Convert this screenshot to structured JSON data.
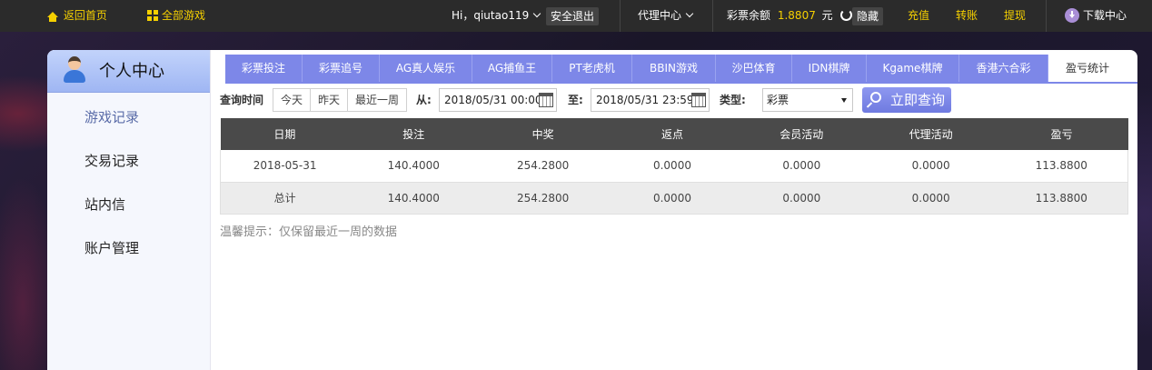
{
  "topbar": {
    "home_label": "返回首页",
    "all_games_label": "全部游戏",
    "greeting": "Hi，qiutao119",
    "logout_label": "安全退出",
    "agent_center_label": "代理中心",
    "balance_label": "彩票余额",
    "balance_value": "1.8807",
    "balance_unit": "元",
    "hide_label": "隐藏",
    "recharge_label": "充值",
    "transfer_label": "转账",
    "withdraw_label": "提现",
    "download_label": "下载中心"
  },
  "sidebar": {
    "title": "个人中心",
    "items": [
      {
        "label": "游戏记录"
      },
      {
        "label": "交易记录"
      },
      {
        "label": "站内信"
      },
      {
        "label": "账户管理"
      }
    ]
  },
  "tabs": [
    {
      "label": "彩票投注"
    },
    {
      "label": "彩票追号"
    },
    {
      "label": "AG真人娱乐"
    },
    {
      "label": "AG捕鱼王"
    },
    {
      "label": "PT老虎机"
    },
    {
      "label": "BBIN游戏"
    },
    {
      "label": "沙巴体育"
    },
    {
      "label": "IDN棋牌"
    },
    {
      "label": "Kgame棋牌"
    },
    {
      "label": "香港六合彩"
    },
    {
      "label": "盈亏统计"
    }
  ],
  "filter": {
    "query_time_label": "查询时间",
    "quick": [
      "今天",
      "昨天",
      "最近一周"
    ],
    "from_label": "从:",
    "from_value": "2018/05/31 00:00",
    "to_label": "至:",
    "to_value": "2018/05/31 23:59",
    "type_label": "类型:",
    "type_value": "彩票",
    "query_button": "立即查询"
  },
  "table": {
    "headers": [
      "日期",
      "投注",
      "中奖",
      "返点",
      "会员活动",
      "代理活动",
      "盈亏"
    ],
    "rows": [
      [
        "2018-05-31",
        "140.4000",
        "254.2800",
        "0.0000",
        "0.0000",
        "0.0000",
        "113.8800"
      ]
    ],
    "total": [
      "总计",
      "140.4000",
      "254.2800",
      "0.0000",
      "0.0000",
      "0.0000",
      "113.8800"
    ]
  },
  "tip": "温馨提示：仅保留最近一周的数据"
}
